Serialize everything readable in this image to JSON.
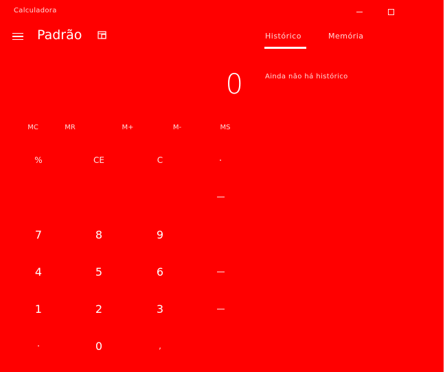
{
  "window": {
    "title": "Calculadora"
  },
  "header": {
    "mode_title": "Padrão"
  },
  "panel": {
    "tabs": [
      "Histórico",
      "Memória"
    ],
    "active_tab_index": 0,
    "empty_message": "Ainda não há histórico"
  },
  "display": {
    "value": "0"
  },
  "memory_buttons": [
    "MC",
    "MR",
    "M+",
    "M-",
    "MS"
  ],
  "keypad": {
    "row0": [
      "%",
      "CE",
      "C"
    ],
    "digits": {
      "seven": "7",
      "eight": "8",
      "nine": "9",
      "four": "4",
      "five": "5",
      "six": "6",
      "one": "1",
      "two": "2",
      "three": "3",
      "zero": "0"
    },
    "plus_minus": "+/-",
    "decimal": ","
  },
  "colors": {
    "background": "#ff0000",
    "foreground": "#ffffff"
  }
}
